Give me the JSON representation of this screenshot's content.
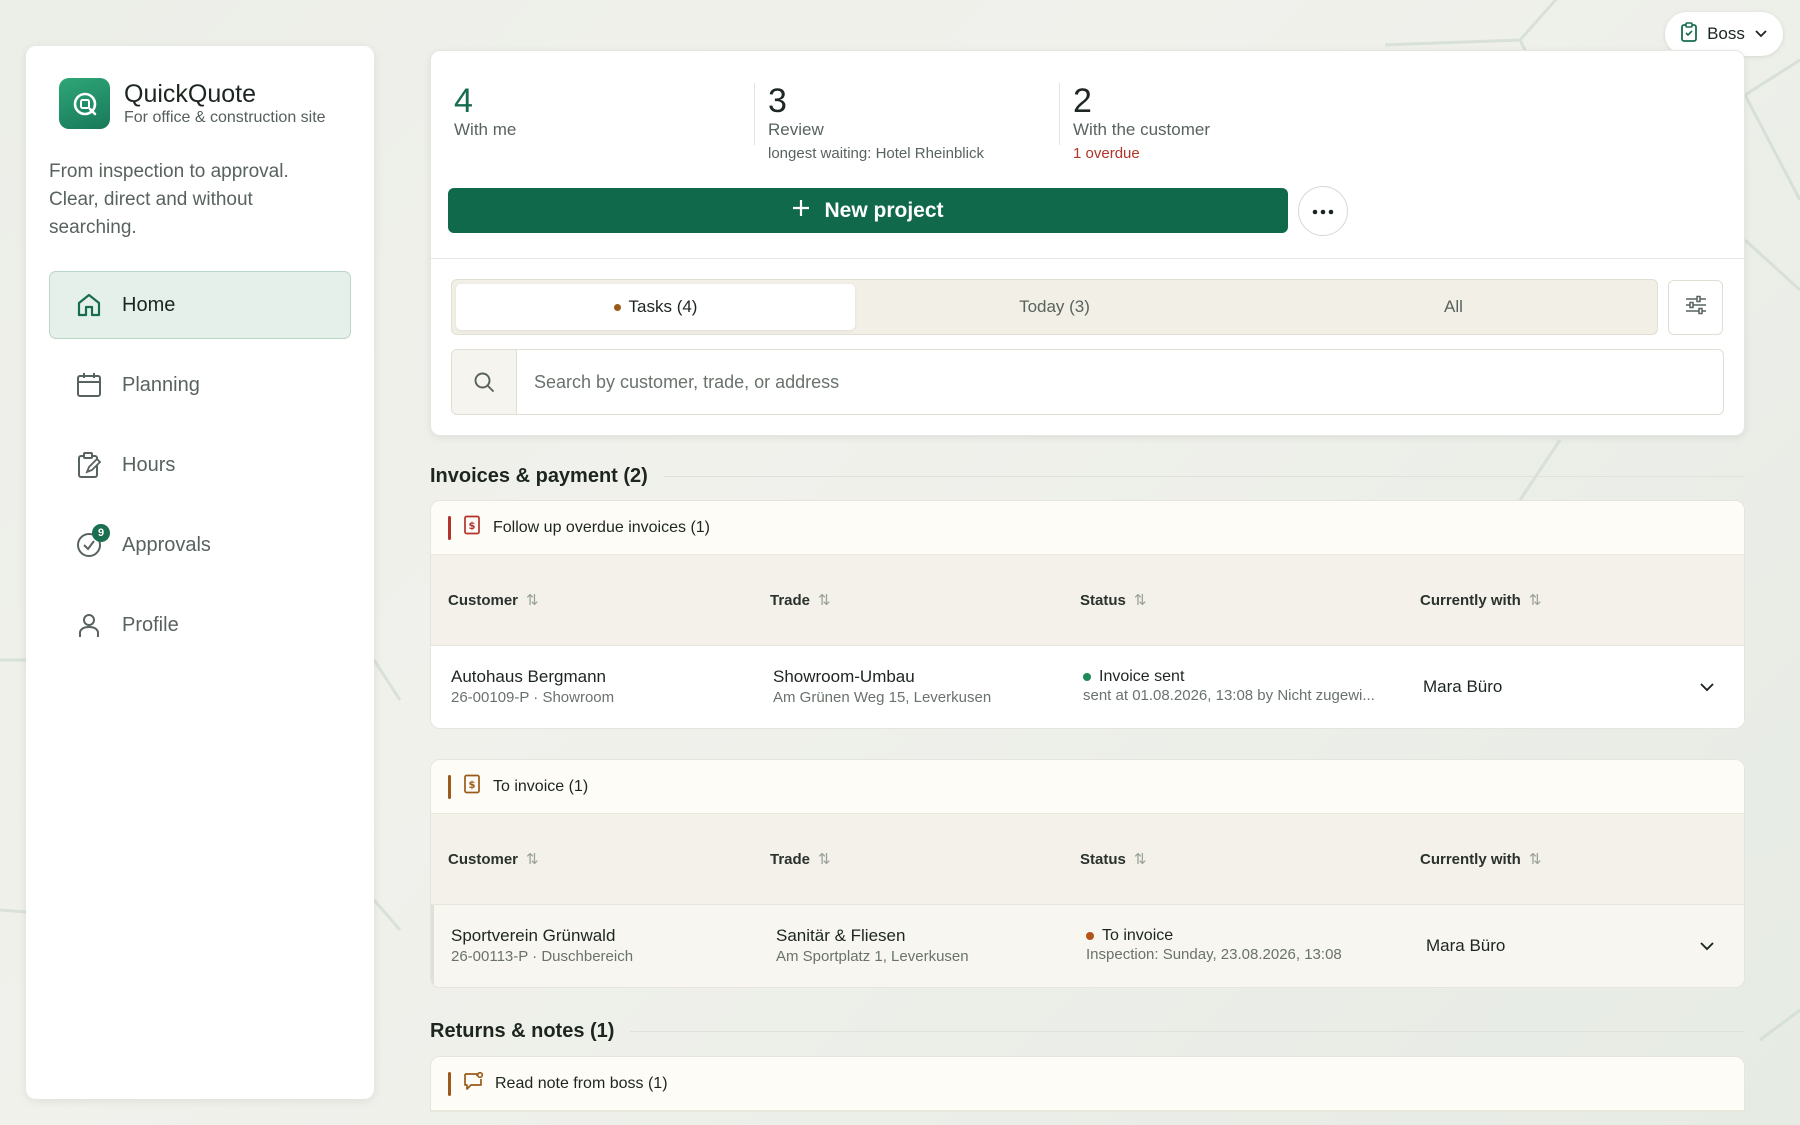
{
  "user_menu": {
    "label": "Boss"
  },
  "brand": {
    "name": "QuickQuote",
    "subtitle": "For office & construction site",
    "tagline": "From inspection to approval. Clear, direct and without searching."
  },
  "nav": {
    "home": "Home",
    "planning": "Planning",
    "hours": "Hours",
    "approvals": "Approvals",
    "approvals_badge": "9",
    "profile": "Profile"
  },
  "stats": [
    {
      "value": "4",
      "label": "With me",
      "sub": ""
    },
    {
      "value": "3",
      "label": "Review",
      "sub": "longest waiting: Hotel Rheinblick"
    },
    {
      "value": "2",
      "label": "With the customer",
      "sub": "1 overdue"
    }
  ],
  "actions": {
    "new_project": "New project"
  },
  "tabs": {
    "tasks": "Tasks (4)",
    "today": "Today (3)",
    "all": "All"
  },
  "search": {
    "placeholder": "Search by customer, trade, or address"
  },
  "columns": {
    "customer": "Customer",
    "trade": "Trade",
    "status": "Status",
    "with": "Currently with"
  },
  "invoices": {
    "title": "Invoices & payment (2)",
    "overdue": {
      "title": "Follow up overdue invoices (1)",
      "row": {
        "customer": "Autohaus Bergmann",
        "customer_sub": "26-00109-P · Showroom",
        "trade": "Showroom-Umbau",
        "trade_sub": "Am Grünen Weg 15, Leverkusen",
        "status": "Invoice sent",
        "status_sub": "sent at 01.08.2026, 13:08 by Nicht zugewi...",
        "with": "Mara Büro"
      }
    },
    "to_invoice": {
      "title": "To invoice (1)",
      "row": {
        "customer": "Sportverein Grünwald",
        "customer_sub": "26-00113-P · Duschbereich",
        "trade": "Sanitär & Fliesen",
        "trade_sub": "Am Sportplatz 1, Leverkusen",
        "status": "To invoice",
        "status_sub": "Inspection: Sunday, 23.08.2026, 13:08",
        "with": "Mara Büro"
      }
    }
  },
  "returns": {
    "title": "Returns & notes (1)",
    "note": {
      "title": "Read note from boss (1)"
    }
  },
  "colors": {
    "primary": "#11694b",
    "overdue": "#b2332a",
    "pending": "#9a5a1a"
  }
}
